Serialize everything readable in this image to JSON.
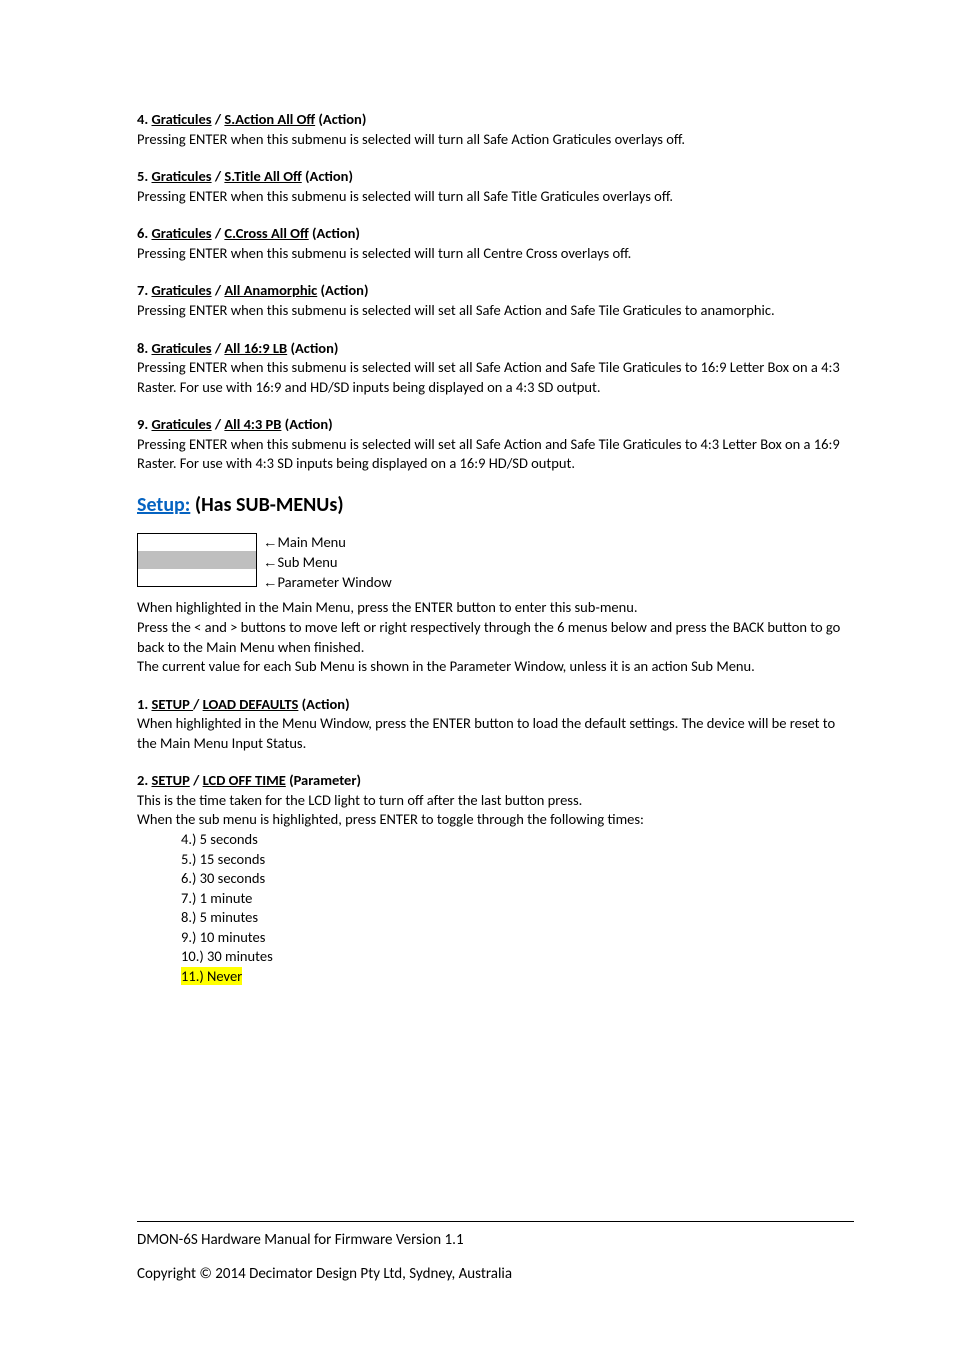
{
  "sections": {
    "s4": {
      "num": "4. ",
      "path1": "Graticules",
      "sep": " / ",
      "path2": "S.Action All Off",
      "suffix": " (Action)",
      "body": "Pressing ENTER when this submenu is selected will turn all Safe Action Graticules overlays off."
    },
    "s5": {
      "num": "5. ",
      "path1": "Graticules",
      "sep": " / ",
      "path2": "S.Title All Off",
      "suffix": " (Action)",
      "body": "Pressing ENTER when this submenu is selected will turn all Safe Title Graticules overlays off."
    },
    "s6": {
      "num": "6. ",
      "path1": "Graticules",
      "sep": " / ",
      "path2": "C.Cross All Off",
      "suffix": " (Action)",
      "body": "Pressing ENTER when this submenu is selected will turn all Centre Cross overlays off."
    },
    "s7": {
      "num": "7. ",
      "path1": "Graticules",
      "sep": " / ",
      "path2": "All Anamorphic",
      "suffix": " (Action)",
      "body": "Pressing ENTER when this submenu is selected will set all Safe Action and Safe Tile Graticules to anamorphic."
    },
    "s8": {
      "num": "8. ",
      "path1": "Graticules",
      "sep": " / ",
      "path2": "All 16:9 LB",
      "suffix": " (Action)",
      "body": "Pressing ENTER when this submenu is selected will set all Safe Action and Safe Tile Graticules to 16:9 Letter Box on a 4:3 Raster.  For use with 16:9 and HD/SD inputs being displayed on a 4:3 SD output."
    },
    "s9": {
      "num": "9. ",
      "path1": "Graticules",
      "sep": " / ",
      "path2": "All 4:3 PB",
      "suffix": " (Action)",
      "body": "Pressing ENTER when this submenu is selected will set all Safe Action and Safe Tile Graticules to 4:3 Letter Box on a 16:9 Raster.  For use with 4:3 SD inputs being displayed on a 16:9 HD/SD output."
    }
  },
  "setup": {
    "link": "Setup:",
    "rest": " (Has SUB-MENUs)"
  },
  "menu_labels": {
    "main": "Main Menu",
    "sub": "Sub Menu",
    "param": "Parameter Window"
  },
  "setup_intro": {
    "l1": "When highlighted in the Main Menu, press the ENTER button to enter this sub-menu.",
    "l2": "Press the < and > buttons to move left or right respectively through the 6 menus below and press the BACK button to go back to the Main Menu when finished.",
    "l3": "The current value for each Sub Menu is shown in the Parameter Window, unless it is an action Sub Menu."
  },
  "setup1": {
    "num": "1. ",
    "path1": "SETUP ",
    "sep": "/ ",
    "path2": "LOAD DEFAULTS",
    "suffix": " (Action)",
    "body": "When highlighted in the Menu Window, press the ENTER button to load the default settings.  The device will be reset to the Main Menu Input Status."
  },
  "setup2": {
    "num": "2. ",
    "path1": "SETUP",
    "sep": " / ",
    "path2": "LCD OFF TIME",
    "suffix": " (Parameter)",
    "body1": "This is the time taken for the LCD light to turn off after the last button press.",
    "body2": "When the sub menu is highlighted, press ENTER to toggle through the following times:"
  },
  "lcd_times": {
    "i4": "4.)   5 seconds",
    "i5": "5.)   15 seconds",
    "i6": "6.)   30 seconds",
    "i7": "7.)   1 minute",
    "i8": "8.)   5 minutes",
    "i9": "9.)   10 minutes",
    "i10": "10.) 30 minutes",
    "i11": "11.) Never"
  },
  "footer": {
    "l1": "DMON-6S Hardware Manual for Firmware Version 1.1",
    "l2": "Copyright © 2014 Decimator Design Pty Ltd, Sydney, Australia"
  }
}
